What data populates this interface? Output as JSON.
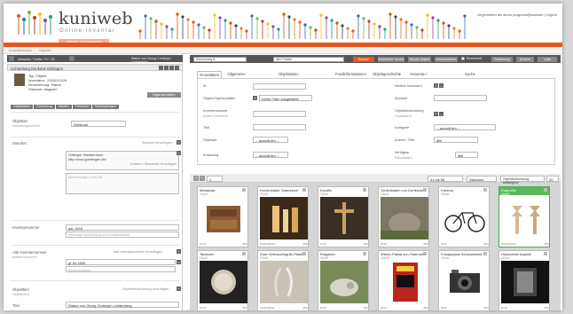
{
  "header": {
    "logo_text": "kuniweb",
    "logo_sub": "Online-Inventar",
    "user_line": "Angemeldet als demo.progress@kuniweb | Logout",
    "tab_label": "Objekte / Inventarisation"
  },
  "breadcrumb": {
    "left": "Inventarisation",
    "right": "Objekte"
  },
  "left_panel": {
    "pager_text": "Aktueller Treffer 70 / 78",
    "pager_right": "Statue von Georg Christoph Lichtenberg",
    "object_title": "Lichtenberg Denkmal Göttingen",
    "info_lines": [
      "Typ: Objekt",
      "Inventarnr.: 2016/1/0124",
      "Bezeichnung: Statue",
      "Standort: Magazin"
    ],
    "eigenschaften_label": "Eigenschaften",
    "sub_tabs": [
      "Objektdaten",
      "Zuordnung",
      "Medien",
      "Personen",
      "Verknüpfungen"
    ],
    "f_objektart_label": "Objektart",
    "f_objektart_sub": "Sammlungsbereich",
    "f_objektart_value": "Denkmal",
    "f_standort_label": "Standort",
    "f_standort_add": "Standort hinzufügen",
    "f_standort_value": "Göttinger Stadtzentrum",
    "f_standort_url": "http://www.goettingen.de/",
    "f_standort_add2": "Quellen / Standorte hinzufügen",
    "f_standort_ph": "Bemerkungen zum Ort",
    "f_inventarnr_label": "Inventarnummer",
    "f_inventarnr_value": "gst_9116",
    "f_inventarnr_ph": "eindeutige Bezeichnung zur Inventarnummer",
    "f_altnr_label": "Alte Inventarnummer",
    "f_altnr_sub": "andere Nummern",
    "f_altnr_add": "Alte Inventarnummer hinzufügen",
    "f_altnr_value": "gt 30-1855",
    "f_altnr_ph": "Bemerkungen",
    "f_objekttitel_label": "Objekttitel",
    "f_objekttitel_sub": "Objektname",
    "f_objekttitel_add": "Objektbezeichnung hinzufügen",
    "f_titel_label": "Titel",
    "f_titel_value": "Statue von Georg Christoph Lichtenberg"
  },
  "toolbar": {
    "scope": "Sammlung A",
    "search_field": "Alle Felder",
    "search_btn": "Suchen",
    "ext_btn": "Erweiterte Suche",
    "new_btn": "Neues Objekt",
    "reset_btn": "Zurücksetzen",
    "check_label": "Bearbeitet",
    "sort_btn": "Sortierung",
    "edit_btn": "Ändern",
    "del_btn": "Liste"
  },
  "form_tabs": [
    "Grunddaten",
    "Allgemeine Informationen",
    "Objektdaten Informationen",
    "Fundinformationen",
    "Objektgeschichte",
    "Verweise / Verknüpfungen",
    "Suche speichern"
  ],
  "form": {
    "l1": "ID",
    "l2": "Objekt-Eigenschaften",
    "v2": "Keine Filter ausgewählt",
    "l3": "Inventarnummer",
    "l3b": "andere Nummern",
    "l4": "Titel",
    "l5": "Objektart",
    "v5": "-- auswählen --",
    "l6": "Erfassung",
    "v6": "-- auswählen --",
    "r1": "Weitere Nummern",
    "r2": "Standort",
    "r3": "Objektbezeichnung",
    "r3b": "Objektname",
    "r4": "Kategorie",
    "v4": "-- auswählen --",
    "r5": "Anzahl / Teile",
    "v5b": "alle",
    "r6": "Verfügbar",
    "r6b": "Exportstatus",
    "v6b": "alle"
  },
  "grid_bar": {
    "count": "1",
    "range": "41 bis 60",
    "sort": "Standard",
    "sort2": "Objektbezeichnung aufsteigend",
    "per_page": "20"
  },
  "cards": [
    {
      "title": "Messkiste",
      "sub": "Objekt",
      "date": "2016",
      "ext": "JPG",
      "sel": false
    },
    {
      "title": "Kerzenhalter Osterkerze",
      "sub": "Objekt",
      "date": "2016/1/0040",
      "ext": "JPG",
      "sel": false
    },
    {
      "title": "Kruzifix",
      "sub": "Objekt",
      "date": "2016",
      "ext": "JPG",
      "sel": false
    },
    {
      "title": "Gedenkstein von Dorfkirche",
      "sub": "Objekt",
      "date": "2016",
      "ext": "JPG",
      "sel": false
    },
    {
      "title": "Fahrrad",
      "sub": "Objekt",
      "date": "2016",
      "ext": "JPG",
      "sel": false
    },
    {
      "title": "Dogenfiel",
      "sub": "Objekt",
      "date": "2016/1/0110",
      "ext": "JPG",
      "sel": true
    },
    {
      "title": "Tamburin",
      "sub": "Objekt",
      "date": "2016",
      "ext": "JPG",
      "sel": false
    },
    {
      "title": "Zwei Gebrauchsgüte-Plastiken",
      "sub": "Objekt",
      "date": "2016/1/0041",
      "ext": "JPG",
      "sel": false
    },
    {
      "title": "Ringstein",
      "sub": "Objekt",
      "date": "2016",
      "ext": "JPG",
      "sel": false
    },
    {
      "title": "Werbe-Plakat von Österreich",
      "sub": "Objekt",
      "date": "2016",
      "ext": "JPG",
      "sel": false
    },
    {
      "title": "Fotoapparat Schwarzweiß",
      "sub": "Objekt",
      "date": "2016",
      "ext": "JPG",
      "sel": false
    },
    {
      "title": "Holzschnitt Kapelle",
      "sub": "Objekt",
      "date": "2016",
      "ext": "JPG",
      "sel": false
    }
  ],
  "colors": {
    "accent": "#e8541a",
    "dark": "#555555",
    "selected": "#5cb85c"
  }
}
